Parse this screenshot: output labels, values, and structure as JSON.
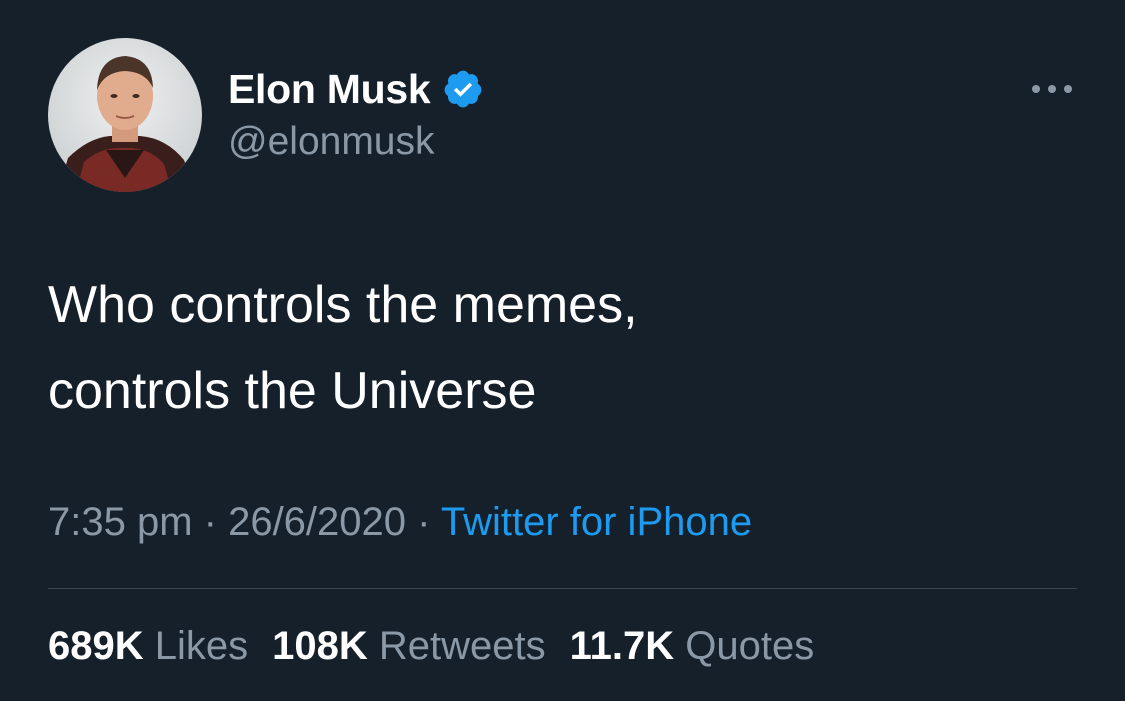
{
  "author": {
    "display_name": "Elon Musk",
    "handle": "@elonmusk",
    "verified": true,
    "avatar_icon": "profile-photo"
  },
  "tweet": {
    "text": "Who controls the memes,\ncontrols the Universe"
  },
  "meta": {
    "time": "7:35 pm",
    "separator": " · ",
    "date": "26/6/2020",
    "source": "Twitter for iPhone"
  },
  "stats": {
    "likes_count": "689K",
    "likes_label": "Likes",
    "retweets_count": "108K",
    "retweets_label": "Retweets",
    "quotes_count": "11.7K",
    "quotes_label": "Quotes"
  },
  "colors": {
    "background": "#15202b",
    "primary_text": "#ffffff",
    "secondary_text": "#8b98a5",
    "accent": "#1d9bf0",
    "divider": "#38444d"
  },
  "icons": {
    "verified": "verified-badge-icon",
    "more": "more-options-icon"
  }
}
